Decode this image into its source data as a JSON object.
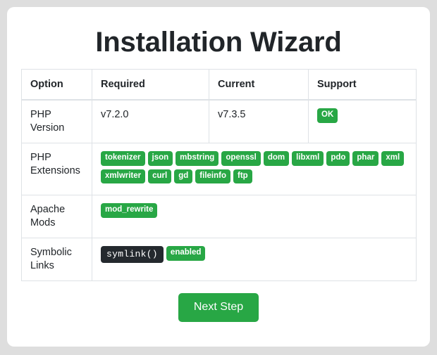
{
  "page": {
    "title": "Installation Wizard",
    "background_color": "#dedede",
    "card_color": "#ffffff",
    "accent_color": "#28a745",
    "dark_badge_color": "#24292e"
  },
  "table": {
    "headers": {
      "option": "Option",
      "required": "Required",
      "current": "Current",
      "support": "Support"
    },
    "rows": [
      {
        "option": "PHP Version",
        "required": "v7.2.0",
        "current": "v7.3.5",
        "support_badges": [
          {
            "label": "OK",
            "style": "green"
          }
        ]
      },
      {
        "option": "PHP Extensions",
        "required_badges": [
          {
            "label": "tokenizer",
            "style": "green"
          },
          {
            "label": "json",
            "style": "green"
          },
          {
            "label": "mbstring",
            "style": "green"
          },
          {
            "label": "openssl",
            "style": "green"
          },
          {
            "label": "dom",
            "style": "green"
          },
          {
            "label": "libxml",
            "style": "green"
          },
          {
            "label": "pdo",
            "style": "green"
          },
          {
            "label": "phar",
            "style": "green"
          },
          {
            "label": "xml",
            "style": "green"
          },
          {
            "label": "xmlwriter",
            "style": "green"
          },
          {
            "label": "curl",
            "style": "green"
          },
          {
            "label": "gd",
            "style": "green"
          },
          {
            "label": "fileinfo",
            "style": "green"
          },
          {
            "label": "ftp",
            "style": "green"
          }
        ]
      },
      {
        "option": "Apache Mods",
        "required_badges": [
          {
            "label": "mod_rewrite",
            "style": "green"
          }
        ]
      },
      {
        "option": "Symbolic Links",
        "required_badges": [
          {
            "label": "symlink()",
            "style": "dark"
          },
          {
            "label": "enabled",
            "style": "green"
          }
        ]
      }
    ]
  },
  "footer": {
    "next_button": "Next Step"
  }
}
